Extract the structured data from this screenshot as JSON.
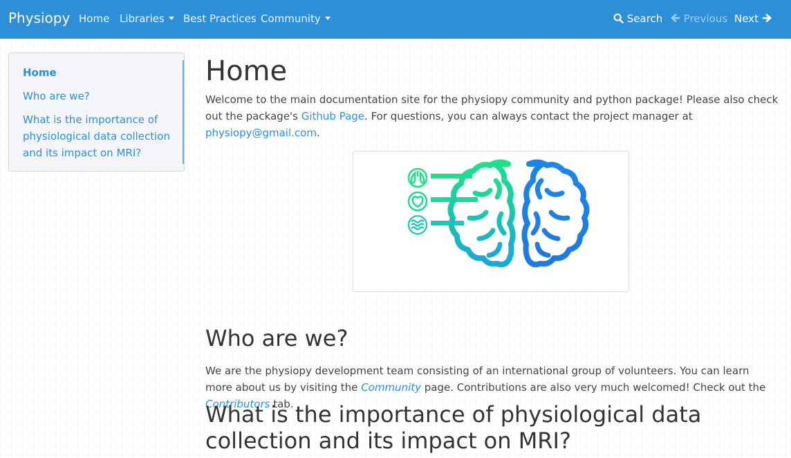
{
  "navbar": {
    "brand": "Physiopy",
    "items": [
      "Home",
      "Libraries",
      "Best Practices",
      "Community"
    ],
    "search_label": "Search",
    "previous_label": "Previous",
    "next_label": "Next"
  },
  "sidebar": {
    "items": [
      "Home",
      "Who are we?",
      "What is the importance of physiological data collection and its impact on MRI?"
    ]
  },
  "main": {
    "title": "Home",
    "intro_1": "Welcome to the main documentation site for the physiopy community and python package! Please also check out the package's ",
    "intro_link": "Github Page",
    "intro_2": ". For questions, you can always contact the project manager at ",
    "intro_email": "physiopy@gmail.com",
    "intro_3": ".",
    "who_title": "Who are we?",
    "who_1": "We are the physiopy development team consisting of an international group of volunteers. You can learn more about us by visiting the ",
    "who_link1": "Community",
    "who_2": " page. Contributions are also very much welcomed! Check out the ",
    "who_link2": "Contributors",
    "who_3": " tab.",
    "importance_title": "What is the importance of physiological data collection and its impact on MRI?"
  },
  "colors": {
    "accent": "#2c8fd8",
    "logo_green": "#1fe08a",
    "logo_blue": "#1d86e6"
  }
}
